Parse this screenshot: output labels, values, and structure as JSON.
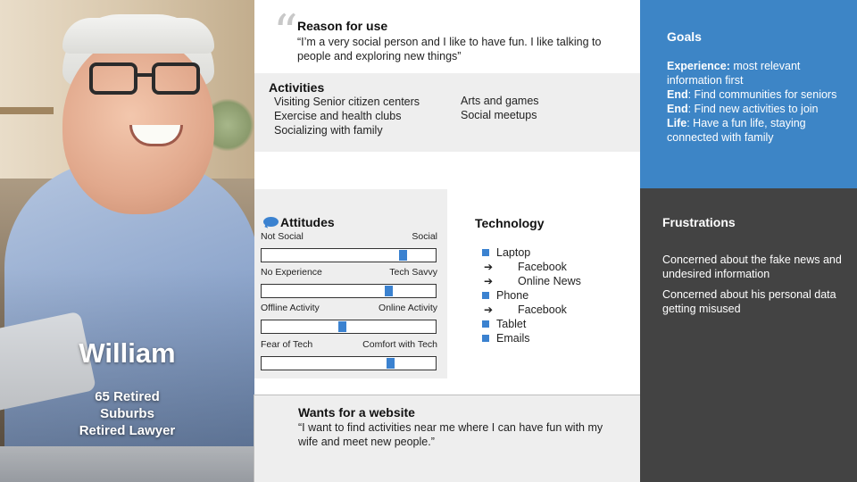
{
  "persona": {
    "name": "William",
    "details": [
      "65 Retired",
      "Suburbs",
      "Retired Lawyer"
    ]
  },
  "reason": {
    "quote_mark": "“",
    "title": "Reason for use",
    "text": "“I’m a  very social person and I like to have fun. I like talking to people and exploring new things”"
  },
  "activities": {
    "title": "Activities",
    "col1": [
      "Visiting Senior citizen centers",
      "Exercise and health clubs",
      "Socializing with family"
    ],
    "col2": [
      "Arts and games",
      "Social meetups"
    ]
  },
  "attitudes": {
    "title": "Attitudes",
    "icon": "speech-bubble-icon",
    "scales": [
      {
        "left": "Not Social",
        "right": "Social",
        "value": 0.83
      },
      {
        "left": "No Experience",
        "right": "Tech Savvy",
        "value": 0.74
      },
      {
        "left": "Offline Activity",
        "right": "Online Activity",
        "value": 0.46
      },
      {
        "left": "Fear of Tech",
        "right": "Comfort with Tech",
        "value": 0.75
      }
    ]
  },
  "technology": {
    "title": "Technology",
    "items": [
      {
        "type": "bullet",
        "label": "Laptop"
      },
      {
        "type": "sub",
        "label": "Facebook"
      },
      {
        "type": "sub",
        "label": "Online News"
      },
      {
        "type": "bullet",
        "label": "Phone"
      },
      {
        "type": "sub",
        "label": "Facebook"
      },
      {
        "type": "bullet",
        "label": "Tablet"
      },
      {
        "type": "bullet",
        "label": "Emails"
      }
    ],
    "arrow_glyph": "➔"
  },
  "goals": {
    "title": "Goals",
    "items": [
      {
        "label": "Experience:",
        "text": " most relevant information first"
      },
      {
        "label": "End",
        "text": ": Find communities for seniors"
      },
      {
        "label": "End",
        "text": ": Find new activities to join"
      },
      {
        "label": "Life",
        "text": ": Have a fun life, staying connected with family"
      }
    ]
  },
  "frustrations": {
    "title": "Frustrations",
    "items": [
      "Concerned about the fake news and undesired information",
      "Concerned about his personal data getting misused"
    ]
  },
  "wants": {
    "title": "Wants for a website",
    "text": "“I want to find activities near me where I can have fun with my wife and meet new people.”"
  },
  "colors": {
    "goals_bg": "#3d85c6",
    "frustrations_bg": "#434343",
    "accent": "#3b82d0",
    "panel_gray": "#eeeeee"
  }
}
